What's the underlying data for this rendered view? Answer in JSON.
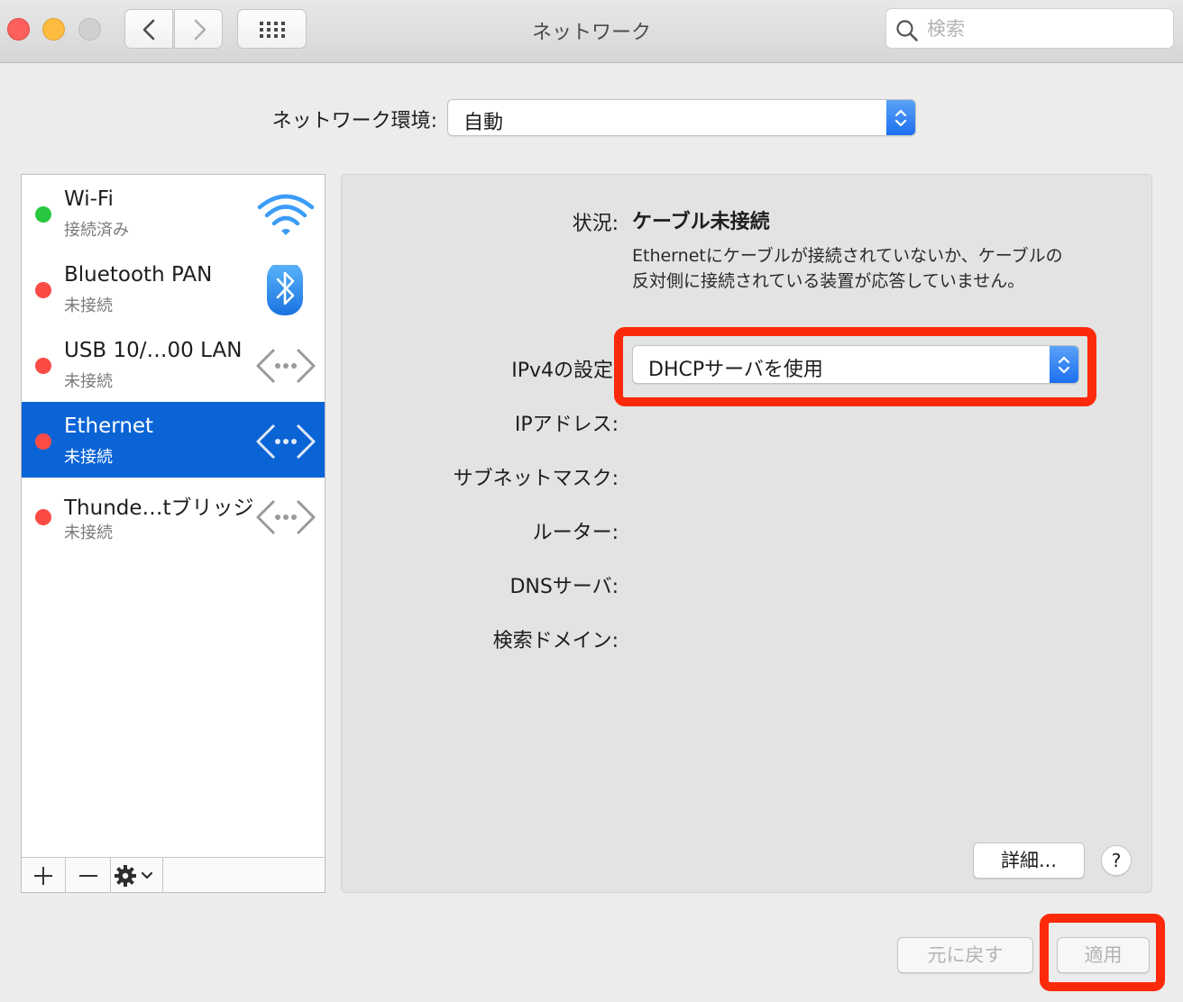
{
  "window": {
    "title": "ネットワーク"
  },
  "search": {
    "placeholder": "検索"
  },
  "location": {
    "label": "ネットワーク環境:",
    "value": "自動"
  },
  "services": [
    {
      "name": "Wi-Fi",
      "status": "接続済み",
      "status_color": "#28c840",
      "icon": "wifi-icon",
      "selected": false
    },
    {
      "name": "Bluetooth PAN",
      "status": "未接続",
      "status_color": "#fc4b45",
      "icon": "bluetooth-icon",
      "selected": false
    },
    {
      "name": "USB 10/…00 LAN",
      "status": "未接続",
      "status_color": "#fc4b45",
      "icon": "ethernet-arrows-icon",
      "selected": false
    },
    {
      "name": "Ethernet",
      "status": "未接続",
      "status_color": "#fc4b45",
      "icon": "ethernet-arrows-icon",
      "selected": true
    },
    {
      "name": "Thunde…tブリッジ",
      "status": "未接続",
      "status_color": "#fc4b45",
      "icon": "ethernet-arrows-icon",
      "selected": false
    }
  ],
  "detail": {
    "status_label": "状況:",
    "status_value": "ケーブル未接続",
    "status_description": "Ethernetにケーブルが接続されていないか、ケーブルの反対側に接続されている装置が応答していません。",
    "ipv4_label": "IPv4の設定",
    "ipv4_value": "DHCPサーバを使用",
    "ip_label": "IPアドレス:",
    "subnet_label": "サブネットマスク:",
    "router_label": "ルーター:",
    "dns_label": "DNSサーバ:",
    "search_domain_label": "検索ドメイン:",
    "advanced_label": "詳細...",
    "help_label": "?"
  },
  "footer": {
    "revert_label": "元に戻す",
    "apply_label": "適用"
  },
  "colors": {
    "selection": "#0a64d6",
    "highlight": "#fc2a0a",
    "accent": "#1c6ff0"
  }
}
